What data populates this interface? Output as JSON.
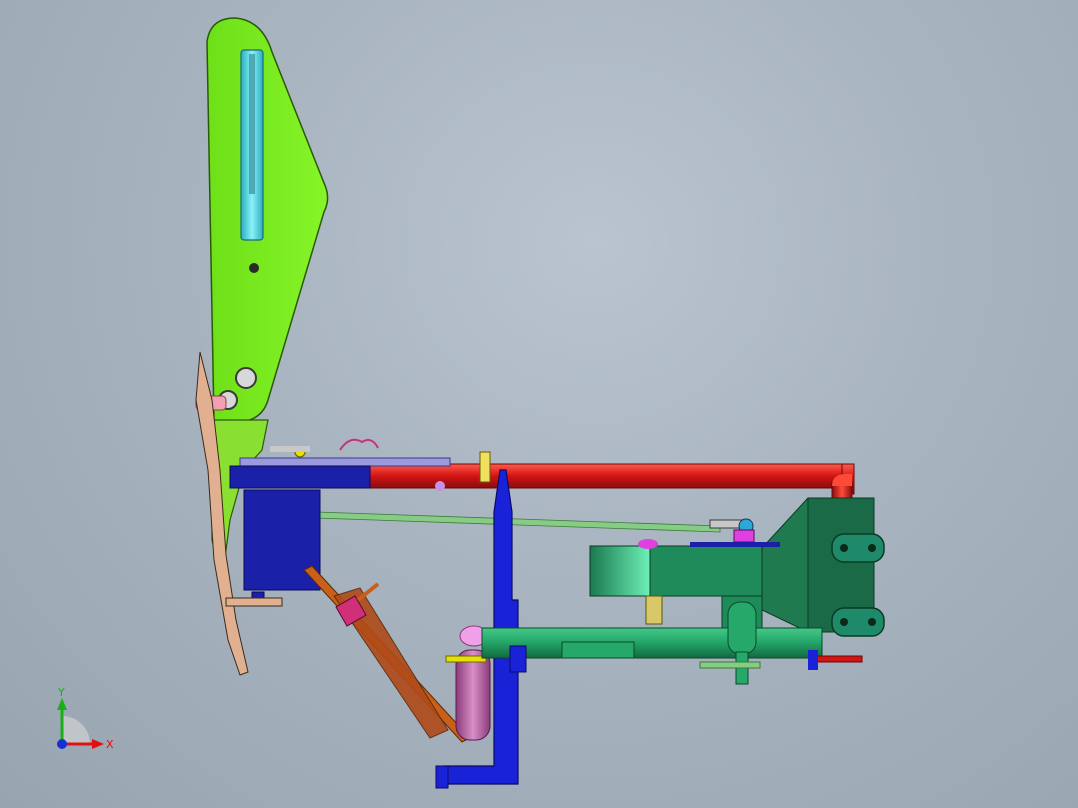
{
  "viewport": {
    "background_top": "#b9c4cf",
    "background_bottom": "#98a4b0"
  },
  "triad": {
    "x_label": "X",
    "y_label": "Y",
    "x_color": "#e01010",
    "y_color": "#18b018",
    "z_color": "#1830d0"
  },
  "colors": {
    "lever_plate": "#7ff022",
    "slot": "#3fd8e0",
    "red_tube": "#d21414",
    "blue_post": "#1a22d8",
    "dark_blue_box": "#1a20a8",
    "teal_frame": "#1f8a5a",
    "green_tube": "#25a86a",
    "green_rod": "#86cc84",
    "link": "#c8601a",
    "pink_tube": "#c070b0",
    "pink_pin": "#f0a0b0"
  },
  "parts": [
    "lever-plate",
    "guide-slot",
    "pivot-pin",
    "upper-pin",
    "pedal-link",
    "red-tube",
    "control-rod",
    "blue-post",
    "blue-box",
    "teal-frame",
    "teal-plate",
    "clamp-plate-top",
    "clamp-plate-bottom",
    "green-tube",
    "pink-elbow",
    "diagonal-link",
    "bottom-foot"
  ]
}
